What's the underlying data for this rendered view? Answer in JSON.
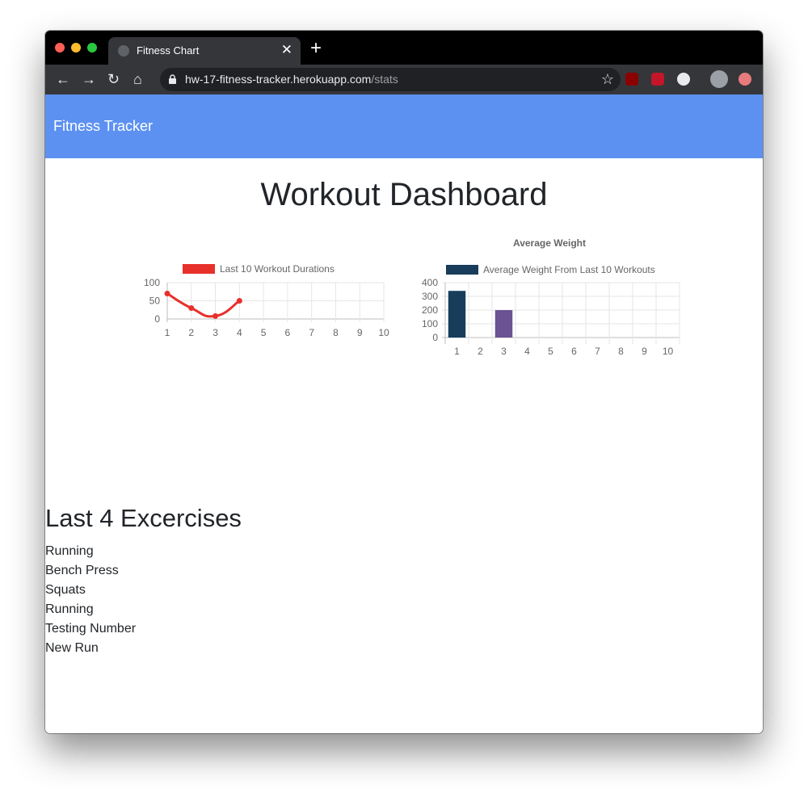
{
  "browser": {
    "tab_title": "Fitness Chart",
    "tab_close": "✕",
    "new_tab": "+",
    "url_host": "hw-17-fitness-tracker.herokuapp.com",
    "url_path": "/stats",
    "nav": {
      "back": "←",
      "forward": "→",
      "reload": "↻",
      "home": "⌂",
      "star": "☆"
    },
    "extensions": [
      {
        "name": "ublock-icon",
        "color": "#8b0000"
      },
      {
        "name": "shield-icon",
        "color": "#c4162a"
      },
      {
        "name": "react-icon",
        "color": "#e8eaed"
      },
      {
        "name": "profile-avatar",
        "color": "#9aa0a6"
      },
      {
        "name": "extension-icon",
        "color": "#e77b7b"
      }
    ]
  },
  "navbar": {
    "brand": "Fitness Tracker",
    "color": "#5c91f2"
  },
  "page": {
    "title": "Workout Dashboard"
  },
  "chart_data": [
    {
      "type": "line",
      "title": "",
      "legend": "Last 10 Workout Durations",
      "legend_position": "top",
      "color": "#e8302b",
      "x": [
        1,
        2,
        3,
        4,
        5,
        6,
        7,
        8,
        9,
        10
      ],
      "y": [
        70,
        30,
        8,
        50
      ],
      "ylim": [
        0,
        100
      ],
      "yticks": [
        0,
        50,
        100
      ],
      "grid": true
    },
    {
      "type": "bar",
      "title": "Average Weight",
      "legend": "Average Weight From Last 10 Workouts",
      "legend_position": "top",
      "legend_color": "#173d5b",
      "categories": [
        "1",
        "2",
        "3",
        "4",
        "5",
        "6",
        "7",
        "8",
        "9",
        "10"
      ],
      "values": [
        340,
        0,
        200,
        0,
        0,
        0,
        0,
        0,
        0,
        0
      ],
      "bar_colors": [
        "#173d5b",
        "#173d5b",
        "#6a5293",
        "#173d5b",
        "#173d5b",
        "#173d5b",
        "#173d5b",
        "#173d5b",
        "#173d5b",
        "#173d5b"
      ],
      "ylim": [
        0,
        400
      ],
      "yticks": [
        0,
        100,
        200,
        300,
        400
      ],
      "grid": true
    }
  ],
  "exercises": {
    "title": "Last 4 Excercises",
    "items": [
      "Running",
      "Bench Press",
      "Squats",
      "Running",
      "Testing Number",
      "New Run"
    ]
  }
}
